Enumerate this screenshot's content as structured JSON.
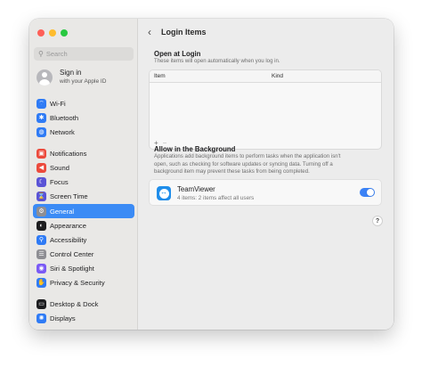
{
  "sidebar": {
    "search_placeholder": "Search",
    "account": {
      "title": "Sign in",
      "subtitle": "with your Apple ID"
    },
    "groups": [
      [
        {
          "label": "Wi-Fi",
          "icon": "wifi-icon",
          "color": "#2f7bf5",
          "glyph": "⌔"
        },
        {
          "label": "Bluetooth",
          "icon": "bluetooth-icon",
          "color": "#2f7bf5",
          "glyph": "✱"
        },
        {
          "label": "Network",
          "icon": "network-icon",
          "color": "#2f7bf5",
          "glyph": "◍"
        }
      ],
      [
        {
          "label": "Notifications",
          "icon": "notifications-icon",
          "color": "#ec4a3c",
          "glyph": "▣"
        },
        {
          "label": "Sound",
          "icon": "sound-icon",
          "color": "#ec4a3c",
          "glyph": "◀"
        },
        {
          "label": "Focus",
          "icon": "focus-icon",
          "color": "#5a53d6",
          "glyph": "☾"
        },
        {
          "label": "Screen Time",
          "icon": "screen-time-icon",
          "color": "#5a53d6",
          "glyph": "⌛"
        }
      ],
      [
        {
          "label": "General",
          "icon": "general-icon",
          "color": "#8e8e93",
          "glyph": "⚙",
          "active": true
        },
        {
          "label": "Appearance",
          "icon": "appearance-icon",
          "color": "#1d1d1f",
          "glyph": "◐"
        },
        {
          "label": "Accessibility",
          "icon": "accessibility-icon",
          "color": "#2f7bf5",
          "glyph": "⚲"
        },
        {
          "label": "Control Center",
          "icon": "control-center-icon",
          "color": "#8e8e93",
          "glyph": "☰"
        },
        {
          "label": "Siri & Spotlight",
          "icon": "siri-icon",
          "color": "#7a5af5",
          "glyph": "◉"
        },
        {
          "label": "Privacy & Security",
          "icon": "privacy-hand-icon",
          "color": "#2f7bf5",
          "glyph": "✋"
        }
      ],
      [
        {
          "label": "Desktop & Dock",
          "icon": "desktop-dock-icon",
          "color": "#1d1d1f",
          "glyph": "▭"
        },
        {
          "label": "Displays",
          "icon": "displays-icon",
          "color": "#2f7bf5",
          "glyph": "✺"
        }
      ]
    ]
  },
  "main": {
    "title": "Login Items",
    "open_at_login": {
      "title": "Open at Login",
      "subtitle": "These items will open automatically when you log in.",
      "columns": [
        "Item",
        "Kind"
      ],
      "add_label": "+",
      "remove_label": "−"
    },
    "background": {
      "title": "Allow in the Background",
      "description_lines": [
        "Applications add background items to perform tasks when the application isn't",
        "open, such as checking for software updates or syncing data. Turning off a",
        "background item may prevent these tasks from being completed."
      ],
      "items": [
        {
          "name": "TeamViewer",
          "detail": "4 items: 2 items affect all users",
          "enabled": true
        }
      ]
    },
    "help_label": "?"
  }
}
